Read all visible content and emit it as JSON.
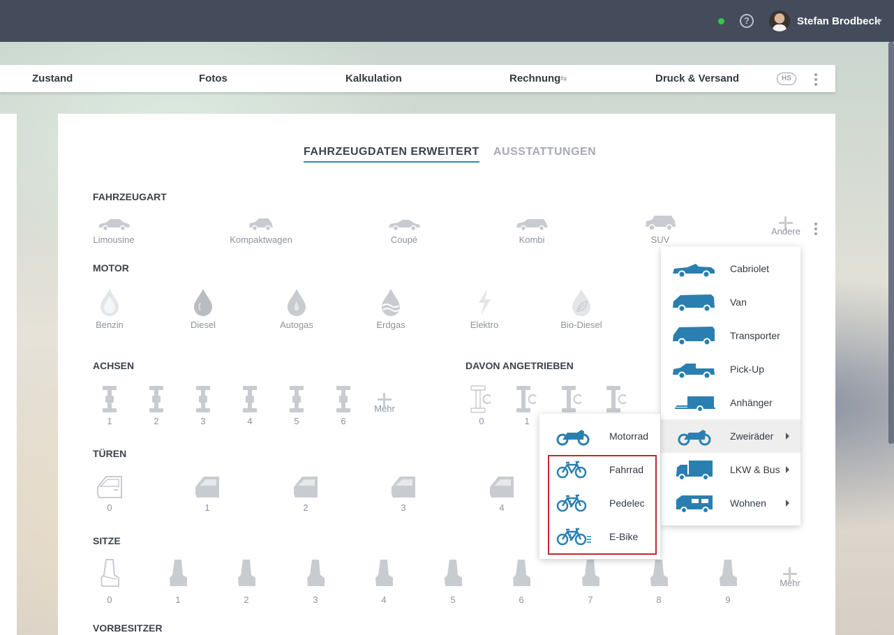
{
  "topbar": {
    "user_name": "Stefan Brodbeck",
    "help_symbol": "?",
    "status_color": "#2ecc40"
  },
  "nav": {
    "items": [
      "Zustand",
      "Fotos",
      "Kalkulation",
      "Rechnung",
      "Druck & Versand"
    ],
    "hs_badge": "HS"
  },
  "tabs": {
    "active": "FAHRZEUGDATEN ERWEITERT",
    "inactive": "AUSSTATTUNGEN"
  },
  "fahrzeugart": {
    "title": "FAHRZEUGART",
    "options": [
      "Limousine",
      "Kompaktwagen",
      "Coupé",
      "Kombi",
      "SUV"
    ],
    "more": "Andere"
  },
  "motor": {
    "title": "MOTOR",
    "options": [
      "Benzin",
      "Diesel",
      "Autogas",
      "Erdgas",
      "Elektro",
      "Bio-Diesel"
    ]
  },
  "achsen": {
    "title": "ACHSEN",
    "options": [
      "1",
      "2",
      "3",
      "4",
      "5",
      "6"
    ],
    "more": "Mehr"
  },
  "angetrieben": {
    "title": "DAVON ANGETRIEBEN",
    "options": [
      "0",
      "1"
    ]
  },
  "tueren": {
    "title": "TÜREN",
    "options": [
      "0",
      "1",
      "2",
      "3",
      "4"
    ]
  },
  "sitze": {
    "title": "SITZE",
    "options": [
      "0",
      "1",
      "2",
      "3",
      "4",
      "5",
      "6",
      "7",
      "8",
      "9"
    ],
    "more": "Mehr"
  },
  "vorbesitzer": {
    "title": "VORBESITZER"
  },
  "menu_andere": {
    "items": [
      "Cabriolet",
      "Van",
      "Transporter",
      "Pick-Up",
      "Anhänger",
      "Zweiräder",
      "LKW & Bus",
      "Wohnen"
    ],
    "icon_color": "#2a7fb0"
  },
  "menu_zweiraeder": {
    "items": [
      "Motorrad",
      "Fahrrad",
      "Pedelec",
      "E-Bike"
    ]
  },
  "colors": {
    "accent": "#2b88b8",
    "icon_gray": "#c2c5ca",
    "highlight": "#c0272d"
  }
}
